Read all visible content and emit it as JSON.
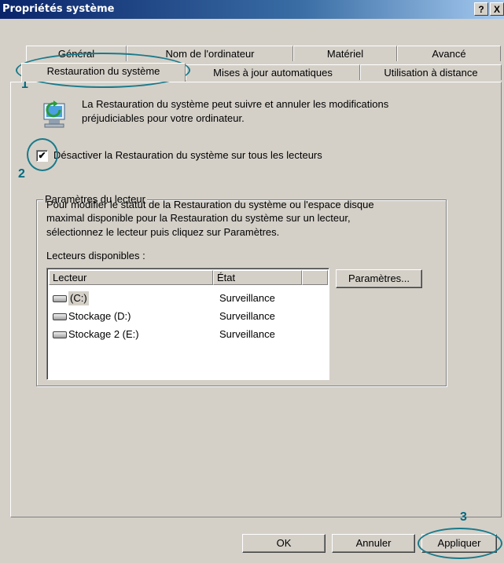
{
  "window": {
    "title": "Propriétés système",
    "help_btn": "?",
    "close_btn": "X"
  },
  "tabs_row1": [
    "Général",
    "Nom de l'ordinateur",
    "Matériel",
    "Avancé"
  ],
  "tabs_row2": [
    "Restauration du système",
    "Mises à jour automatiques",
    "Utilisation à distance"
  ],
  "intro": {
    "line1": "La Restauration du système peut suivre et annuler les modifications",
    "line2": "préjudiciables pour votre ordinateur."
  },
  "disable_checkbox": {
    "label": "Désactiver la Restauration du système sur tous les lecteurs",
    "checked": true,
    "mark": "✔"
  },
  "group": {
    "legend": "Paramètres du lecteur",
    "desc1": "Pour modifier le statut de la Restauration du système ou l'espace disque",
    "desc2": "maximal disponible pour la Restauration du système sur un lecteur,",
    "desc3": "sélectionnez le lecteur puis cliquez sur Paramètres.",
    "drives_label": "Lecteurs disponibles :",
    "columns": [
      "Lecteur",
      "État"
    ],
    "drives": [
      {
        "name": "(C:)",
        "state": "Surveillance"
      },
      {
        "name": "Stockage (D:)",
        "state": "Surveillance"
      },
      {
        "name": "Stockage 2 (E:)",
        "state": "Surveillance"
      }
    ],
    "settings_button": "Paramètres..."
  },
  "buttons": {
    "ok": "OK",
    "cancel": "Annuler",
    "apply": "Appliquer"
  },
  "annotations": {
    "a1": "1",
    "a2": "2",
    "a3": "3"
  }
}
